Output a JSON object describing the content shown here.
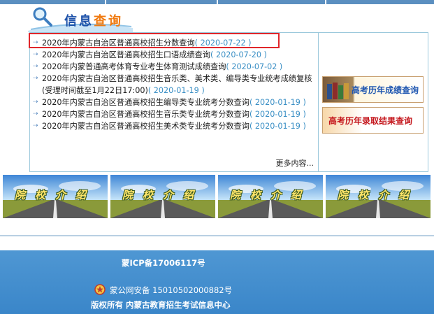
{
  "header": {
    "title_part1": "信息",
    "title_part2": "查询"
  },
  "news": [
    {
      "title": "2020年内蒙古自治区普通高校招生分数查询",
      "date": "( 2020-07-22 )"
    },
    {
      "title": "2020年内蒙古自治区普通高校招生口语成绩查询",
      "date": "( 2020-07-20 )"
    },
    {
      "title": "2020年内蒙普通高考体育专业考生体育测试成绩查询",
      "date": "( 2020-07-02 )"
    },
    {
      "title": "2020年内蒙古自治区普通高校招生音乐类、美术类、编导类专业统考成绩复核(受理时间截至1月22日17:00)",
      "date": "( 2020-01-19 )"
    },
    {
      "title": "2020年内蒙古自治区普通高校招生编导类专业统考分数查询",
      "date": "( 2020-01-19 )"
    },
    {
      "title": "2020年内蒙古自治区普通高校招生音乐类专业统考分数查询",
      "date": "( 2020-01-19 )"
    },
    {
      "title": "2020年内蒙古自治区普通高校招生美术类专业统考分数查询",
      "date": "( 2020-01-19 )"
    }
  ],
  "more_label": "更多内容...",
  "side_banners": [
    {
      "label": "高考历年成绩查询"
    },
    {
      "label": "高考历年录取结果查询"
    }
  ],
  "school_banners": [
    {
      "label": "院校介绍"
    },
    {
      "label": "院校介绍"
    },
    {
      "label": "院校介绍"
    },
    {
      "label": "院校介绍"
    }
  ],
  "footer": {
    "icp": "蒙ICP备17006117号",
    "police": "蒙公网安备 15010502000882号",
    "copyright": "版权所有 内蒙古教育招生考试信息中心"
  },
  "colors": {
    "accent_blue": "#1a4fa8",
    "accent_orange": "#f07a10",
    "date_blue": "#3a8fc5",
    "highlight_red": "#e0262b",
    "footer_blue": "#3a86c9"
  }
}
